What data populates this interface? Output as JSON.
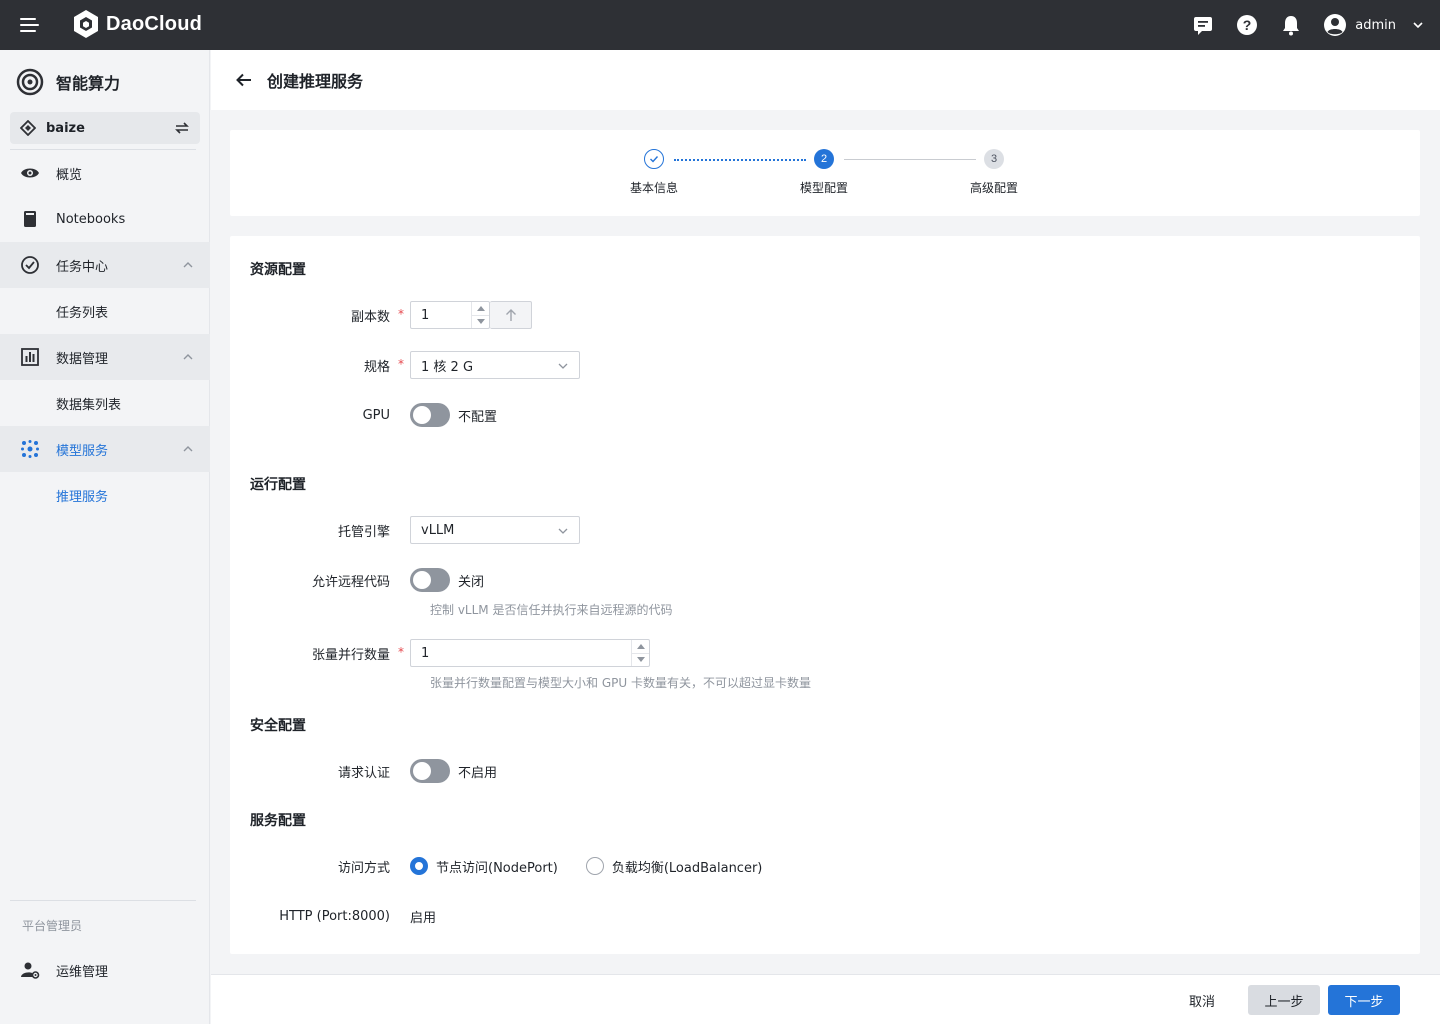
{
  "topbar": {
    "brand": "DaoCloud",
    "username": "admin"
  },
  "sidebar": {
    "product_name": "智能算力",
    "workspace": "baize",
    "items": [
      {
        "label": "概览"
      },
      {
        "label": "Notebooks"
      },
      {
        "label": "任务中心"
      },
      {
        "label": "任务列表"
      },
      {
        "label": "数据管理"
      },
      {
        "label": "数据集列表"
      },
      {
        "label": "模型服务"
      },
      {
        "label": "推理服务"
      }
    ],
    "admin_caption": "平台管理员",
    "admin_item": "运维管理"
  },
  "page": {
    "title": "创建推理服务"
  },
  "steps": [
    {
      "label": "基本信息",
      "state": "done",
      "num": ""
    },
    {
      "label": "模型配置",
      "state": "active",
      "num": "2"
    },
    {
      "label": "高级配置",
      "state": "pending",
      "num": "3"
    }
  ],
  "form": {
    "resource": {
      "title": "资源配置",
      "replicas_label": "副本数",
      "replicas_value": "1",
      "spec_label": "规格",
      "spec_value": "1 核 2 G",
      "gpu_label": "GPU",
      "gpu_toggle_text": "不配置"
    },
    "runtime": {
      "title": "运行配置",
      "engine_label": "托管引擎",
      "engine_value": "vLLM",
      "remote_code_label": "允许远程代码",
      "remote_code_toggle_text": "关闭",
      "remote_code_hint": "控制 vLLM 是否信任并执行来自远程源的代码",
      "tp_label": "张量并行数量",
      "tp_value": "1",
      "tp_hint": "张量并行数量配置与模型大小和 GPU 卡数量有关，不可以超过显卡数量"
    },
    "security": {
      "title": "安全配置",
      "auth_label": "请求认证",
      "auth_toggle_text": "不启用"
    },
    "service": {
      "title": "服务配置",
      "access_label": "访问方式",
      "access_options": [
        "节点访问(NodePort)",
        "负载均衡(LoadBalancer)"
      ],
      "access_selected": "节点访问(NodePort)",
      "http_label": "HTTP (Port:8000)",
      "http_value": "启用"
    }
  },
  "footer": {
    "cancel": "取消",
    "prev": "上一步",
    "next": "下一步"
  },
  "colors": {
    "primary": "#2474d8",
    "topbar": "#2e3035",
    "required": "#e5484d",
    "toggle_off": "#8f959e"
  }
}
